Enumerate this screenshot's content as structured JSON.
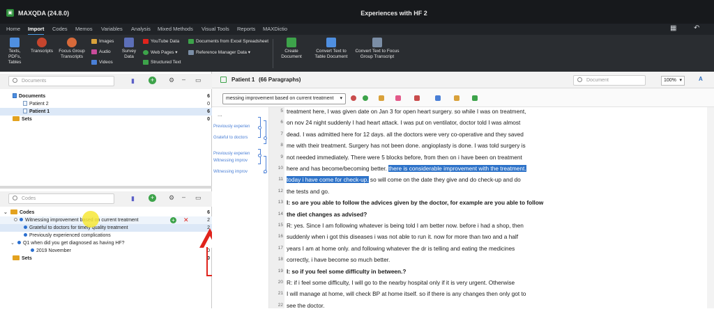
{
  "app": {
    "title": "MAXQDA (24.8.0)",
    "document_title": "Experiences with HF 2"
  },
  "menu": [
    "Home",
    "Import",
    "Codes",
    "Memos",
    "Variables",
    "Analysis",
    "Mixed Methods",
    "Visual Tools",
    "Reports",
    "MAXDictio"
  ],
  "ribbon": {
    "texts": "Texts, PDFs, Tables",
    "transcripts": "Transcripts",
    "focus_group": "Focus Group Transcripts",
    "images": "Images",
    "audio": "Audio",
    "videos": "Videos",
    "survey": "Survey Data",
    "youtube": "YouTube Data",
    "webpages": "Web Pages",
    "structured": "Structured Text",
    "excel": "Documents from Excel Spreadsheet",
    "refmgr": "Reference Manager Data",
    "create_doc": "Create Document",
    "convert_table": "Convert Text to Table Document",
    "convert_focus": "Convert Text to Focus Group Transcript"
  },
  "documents_panel": {
    "search_placeholder": "Documents",
    "root": {
      "label": "Documents",
      "count": "6"
    },
    "items": [
      {
        "label": "Patient 2",
        "count": "0"
      },
      {
        "label": "Patient 1",
        "count": "6"
      }
    ],
    "sets": {
      "label": "Sets",
      "count": "0"
    }
  },
  "codes_panel": {
    "search_placeholder": "Codes",
    "root": {
      "label": "Codes",
      "count": "6"
    },
    "items": [
      {
        "label": "Witnessing improvement based on current treatment",
        "count": "2"
      },
      {
        "label": "Grateful to doctors for timely quality treatment",
        "count": "2"
      },
      {
        "label": "Previously experienced complications",
        "count": "2"
      },
      {
        "label": "Q1 when did you get diagnosed as having HF?",
        "count": "0"
      },
      {
        "label": "2019 November",
        "count": "0"
      }
    ],
    "sets": {
      "label": "Sets",
      "count": "0"
    }
  },
  "document_view": {
    "header": "Patient 1",
    "paragraphs": "(66 Paragraphs)",
    "search_placeholder": "Document",
    "zoom": "100%",
    "code_dropdown": "messing improvement based on current treatment",
    "dots": "...",
    "stripe_labels": [
      "Previously experien",
      "Grateful to doctors",
      "Previously experien",
      "Witnessing improv",
      "Witnessing improv"
    ],
    "lines": [
      {
        "n": "5",
        "text": "treatment here, I was given date on Jan 3 for open heart surgery. so while I was on treatment,"
      },
      {
        "n": "6",
        "text": "on nov 24 night suddenly I had heart attack. I was put on ventilator, doctor told I was almost"
      },
      {
        "n": "7",
        "text": "dead. I was admitted here for 12 days. all the doctors were very co-operative and they saved"
      },
      {
        "n": "8",
        "text": "me with their treatment. Surgery has not been done. angioplasty is done. I was told surgery is"
      },
      {
        "n": "9",
        "text": "not needed immediately. There were 5 blocks before, from then on i have been on treatment"
      },
      {
        "n": "10",
        "text": "here and has become/becoming better.",
        "hl": "there is considerable improvement with the treatment."
      },
      {
        "n": "11",
        "hl": "today i have come for check-up.",
        "text": " so will come on the date they give and do check-up and do"
      },
      {
        "n": "12",
        "text": "the tests and go."
      },
      {
        "n": "13",
        "text": "I: so are you able to follow the advices given by the doctor, for example are you able to follow",
        "bold": true
      },
      {
        "n": "14",
        "text": "the diet changes as advised?",
        "bold": true
      },
      {
        "n": "15",
        "text": "R: yes. Since I am following whatever is being told I am better now. before i had a shop, then"
      },
      {
        "n": "16",
        "text": "suddenly when i got this diseases i was not able to run it. now for more than two and a half"
      },
      {
        "n": "17",
        "text": "years I am at home only. and following whatever the dr is telling and eating the medicines"
      },
      {
        "n": "18",
        "text": "correctly, i have become so much better."
      },
      {
        "n": "19",
        "text": "I: so if you feel some difficulty in between.?",
        "bold": true
      },
      {
        "n": "20",
        "text": "R: if i feel some difficulty, I will go to the nearby hospital only if it is very urgent. Otherwise"
      },
      {
        "n": "21",
        "text": "I will manage at home, will check BP at home itself. so if there is any changes then only got to"
      },
      {
        "n": "22",
        "text": "see the doctor."
      }
    ]
  },
  "colors": {
    "titlebar": "#17191c",
    "ribbon": "#2a2d31",
    "highlight": "#2e73c9",
    "accent_arrow": "#e0231c"
  }
}
